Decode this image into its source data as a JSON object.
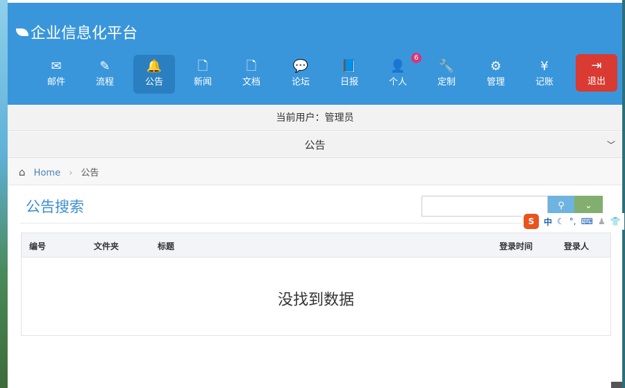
{
  "brand": {
    "title": "企业信息化平台"
  },
  "nav": [
    {
      "label": "邮件",
      "icon": "✉"
    },
    {
      "label": "流程",
      "icon": "✎"
    },
    {
      "label": "公告",
      "icon": "🔔",
      "active": true
    },
    {
      "label": "新闻",
      "icon": "🗋"
    },
    {
      "label": "文档",
      "icon": "🗋"
    },
    {
      "label": "论坛",
      "icon": "💬"
    },
    {
      "label": "日报",
      "icon": "📘"
    },
    {
      "label": "个人",
      "icon": "👤",
      "badge": "6"
    },
    {
      "label": "定制",
      "icon": "🔧"
    },
    {
      "label": "管理",
      "icon": "⚙"
    },
    {
      "label": "记账",
      "icon": "¥"
    },
    {
      "label": "退出",
      "icon": "⇥"
    }
  ],
  "userbar": {
    "text": "当前用户：管理员"
  },
  "accordion": {
    "label": "公告"
  },
  "breadcrumb": {
    "home": "Home",
    "current": "公告"
  },
  "main": {
    "title": "公告搜索",
    "search_value": "",
    "columns": [
      "编号",
      "文件夹",
      "标题",
      "登录时间",
      "登录人"
    ],
    "empty": "没找到数据"
  },
  "ime": {
    "mode": "中"
  }
}
